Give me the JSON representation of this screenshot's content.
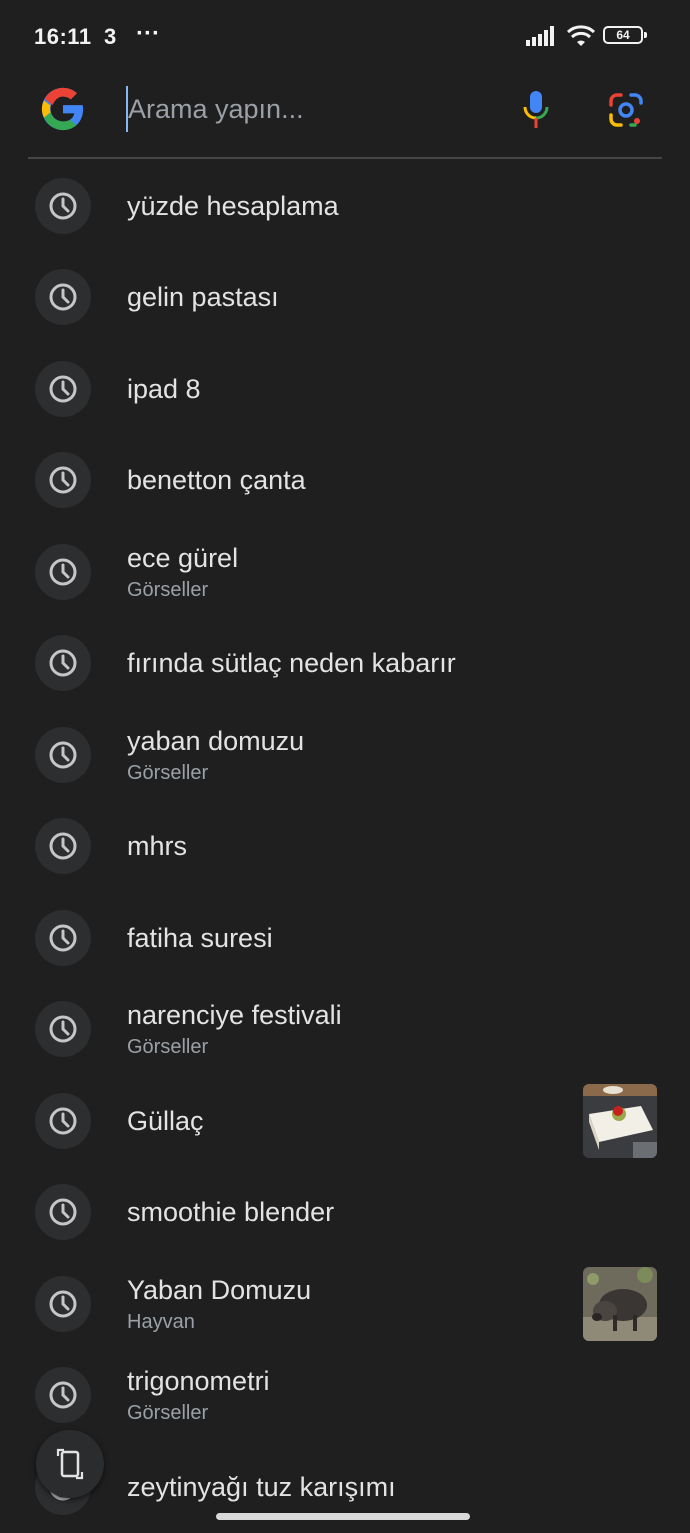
{
  "status_bar": {
    "time": "16:11",
    "notification_count": "3",
    "more": "···",
    "battery": "64"
  },
  "search": {
    "placeholder": "Arama yapın..."
  },
  "history": [
    {
      "title": "yüzde hesaplama",
      "subtitle": ""
    },
    {
      "title": "gelin pastası",
      "subtitle": ""
    },
    {
      "title": "ipad 8",
      "subtitle": ""
    },
    {
      "title": "benetton çanta",
      "subtitle": ""
    },
    {
      "title": "ece gürel",
      "subtitle": "Görseller"
    },
    {
      "title": "fırında sütlaç neden kabarır",
      "subtitle": ""
    },
    {
      "title": "yaban domuzu",
      "subtitle": "Görseller"
    },
    {
      "title": "mhrs",
      "subtitle": ""
    },
    {
      "title": "fatiha suresi",
      "subtitle": ""
    },
    {
      "title": "narenciye festivali",
      "subtitle": "Görseller"
    },
    {
      "title": "Güllaç",
      "subtitle": "",
      "thumbnail": "gullac-dessert"
    },
    {
      "title": "smoothie blender",
      "subtitle": ""
    },
    {
      "title": "Yaban Domuzu",
      "subtitle": "Hayvan",
      "thumbnail": "wild-boar"
    },
    {
      "title": "trigonometri",
      "subtitle": "Görseller"
    },
    {
      "title": "zeytinyağı tuz karışımı",
      "subtitle": ""
    }
  ],
  "colors": {
    "background": "#1f1f1f",
    "text": "#e3e3e3",
    "subtext": "#9aa0a6",
    "icon_circle": "#2d2e30"
  },
  "icons": {
    "history": "clock-icon",
    "voice": "mic-icon",
    "lens": "google-lens-icon",
    "floating": "rotate-screen-icon"
  }
}
